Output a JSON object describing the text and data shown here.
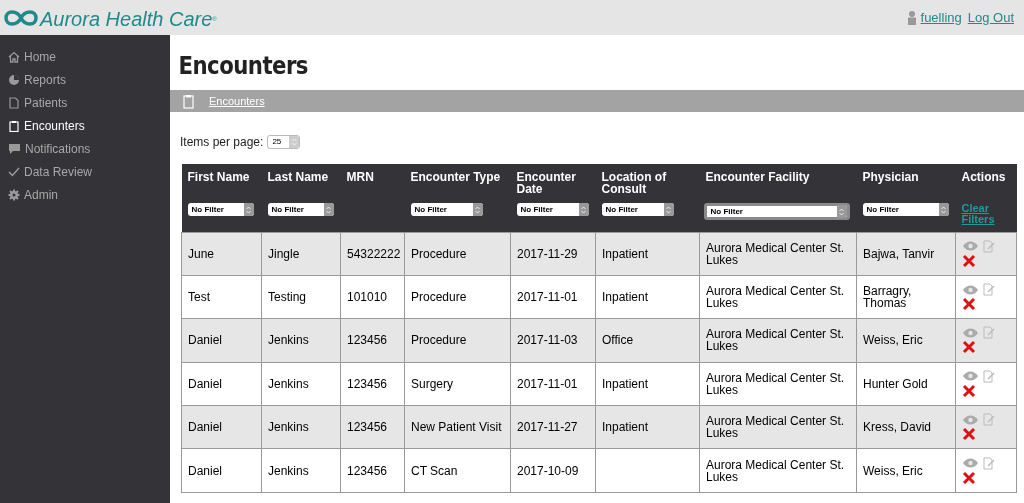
{
  "header": {
    "logo_text": "Aurora Health Care",
    "logo_mark": "®",
    "user": "fuelling",
    "logout": "Log Out"
  },
  "sidebar": {
    "items": [
      {
        "label": "Home",
        "selected": false
      },
      {
        "label": "Reports",
        "selected": false
      },
      {
        "label": "Patients",
        "selected": false
      },
      {
        "label": "Encounters",
        "selected": true
      },
      {
        "label": "Notifications",
        "selected": false
      },
      {
        "label": "Data Review",
        "selected": false
      },
      {
        "label": "Admin",
        "selected": false
      }
    ]
  },
  "page_title": "Encounters",
  "breadcrumb": "Encounters",
  "items_per_page": {
    "label": "Items per page:",
    "value": "25"
  },
  "table": {
    "columns": [
      {
        "label": "First Name",
        "filter": "No Filter",
        "focused": false
      },
      {
        "label": "Last Name",
        "filter": "No Filter",
        "focused": false
      },
      {
        "label": "MRN"
      },
      {
        "label": "Encounter Type",
        "filter": "No Filter",
        "focused": false
      },
      {
        "label": "Encounter Date",
        "filter": "No Filter",
        "focused": false
      },
      {
        "label": "Location of Consult",
        "filter": "No Filter",
        "focused": false
      },
      {
        "label": "Encounter Facility",
        "filter": "No Filter",
        "focused": true
      },
      {
        "label": "Physician",
        "filter": "No Filter",
        "focused": false
      },
      {
        "label": "Actions",
        "clear": "Clear Filters"
      }
    ],
    "rows": [
      [
        "June",
        "Jingle",
        "54322222",
        "Procedure",
        "2017-11-29",
        "Inpatient",
        "Aurora Medical Center St. Lukes",
        "Bajwa, Tanvir"
      ],
      [
        "Test",
        "Testing",
        "101010",
        "Procedure",
        "2017-11-01",
        "Inpatient",
        "Aurora Medical Center St. Lukes",
        "Barragry, Thomas"
      ],
      [
        "Daniel",
        "Jenkins",
        "123456",
        "Procedure",
        "2017-11-03",
        "Office",
        "Aurora Medical Center St. Lukes",
        "Weiss, Eric"
      ],
      [
        "Daniel",
        "Jenkins",
        "123456",
        "Surgery",
        "2017-11-01",
        "Inpatient",
        "Aurora Medical Center St. Lukes",
        "Hunter Gold"
      ],
      [
        "Daniel",
        "Jenkins",
        "123456",
        "New Patient Visit",
        "2017-11-27",
        "Inpatient",
        "Aurora Medical Center St. Lukes",
        "Kress, David"
      ],
      [
        "Daniel",
        "Jenkins",
        "123456",
        "CT Scan",
        "2017-10-09",
        "",
        "Aurora Medical Center St. Lukes",
        "Weiss, Eric"
      ]
    ]
  }
}
